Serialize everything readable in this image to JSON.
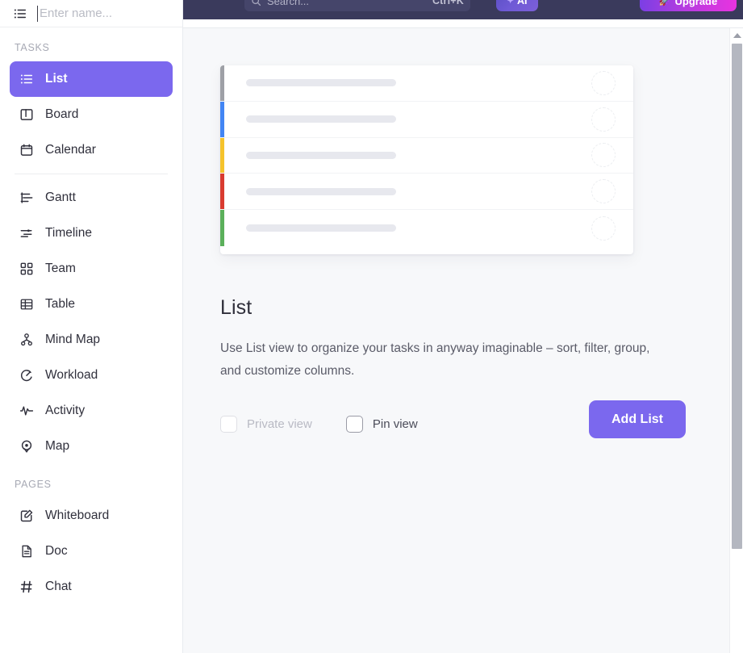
{
  "header": {
    "search": {
      "placeholder": "Search...",
      "shortcut": "Ctrl+K",
      "icon": "search-icon"
    },
    "ai_button": {
      "label": "AI",
      "icon": "sparkle-icon"
    },
    "upgrade_button": {
      "label": "Upgrade",
      "icon": "rocket-icon"
    }
  },
  "name_input": {
    "placeholder": "Enter name...",
    "value": "",
    "icon": "list-icon"
  },
  "sidebar": {
    "sections": [
      {
        "label": "TASKS",
        "items": [
          {
            "label": "List",
            "icon": "list-icon",
            "active": true
          },
          {
            "label": "Board",
            "icon": "board-icon",
            "active": false
          },
          {
            "label": "Calendar",
            "icon": "calendar-icon",
            "active": false
          },
          {
            "label": "Gantt",
            "icon": "gantt-icon",
            "active": false
          },
          {
            "label": "Timeline",
            "icon": "timeline-icon",
            "active": false
          },
          {
            "label": "Team",
            "icon": "team-icon",
            "active": false
          },
          {
            "label": "Table",
            "icon": "table-icon",
            "active": false
          },
          {
            "label": "Mind Map",
            "icon": "mind-map-icon",
            "active": false
          },
          {
            "label": "Workload",
            "icon": "workload-icon",
            "active": false
          },
          {
            "label": "Activity",
            "icon": "activity-icon",
            "active": false
          },
          {
            "label": "Map",
            "icon": "map-pin-icon",
            "active": false
          }
        ]
      },
      {
        "label": "PAGES",
        "items": [
          {
            "label": "Whiteboard",
            "icon": "whiteboard-icon",
            "active": false
          },
          {
            "label": "Doc",
            "icon": "doc-icon",
            "active": false
          },
          {
            "label": "Chat",
            "icon": "hash-icon",
            "active": false
          }
        ]
      }
    ]
  },
  "main": {
    "preview": {
      "rows": [
        {
          "color": "#9ea0a6"
        },
        {
          "color": "#4285f4"
        },
        {
          "color": "#f5c32c"
        },
        {
          "color": "#d93b30"
        },
        {
          "color": "#5bb05b"
        }
      ]
    },
    "title": "List",
    "description": "Use List view to organize your tasks in anyway imaginable – sort, filter, group, and customize columns.",
    "private_view": {
      "label": "Private view",
      "checked": false,
      "disabled": true
    },
    "pin_view": {
      "label": "Pin view",
      "checked": false,
      "disabled": false
    },
    "add_button": "Add List"
  },
  "colors": {
    "accent": "#7b68ee",
    "topbar": "#3a3a5c",
    "content_bg": "#f7f8fa",
    "upgrade_gradient_start": "#7b3fe4",
    "upgrade_gradient_end": "#e933e0"
  }
}
